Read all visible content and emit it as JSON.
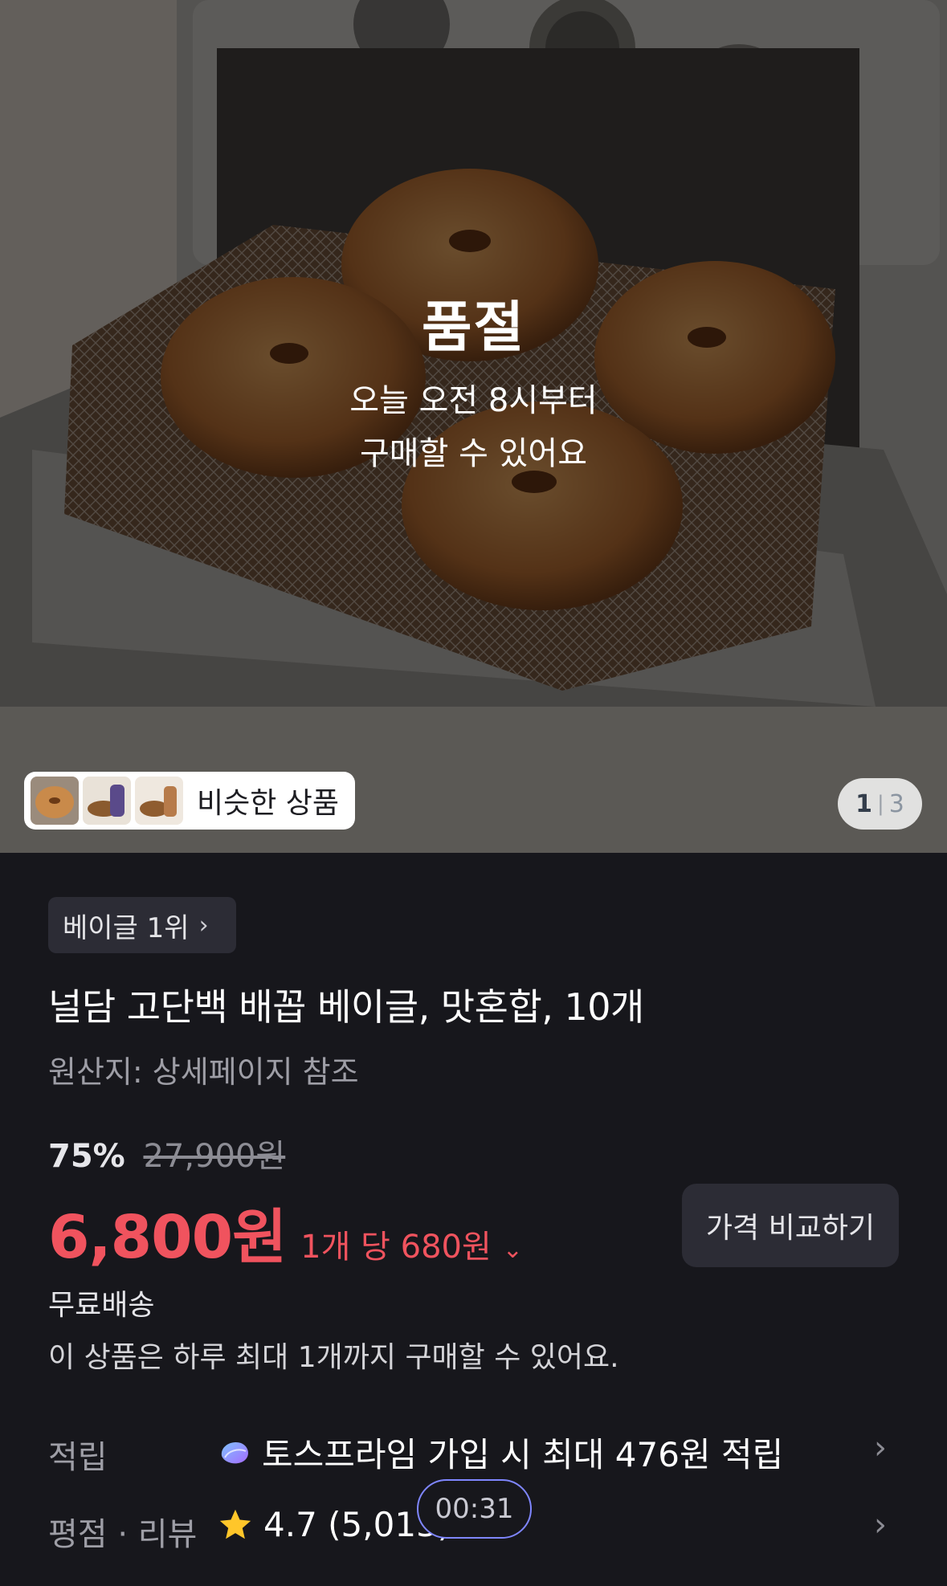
{
  "hero": {
    "soldout_title": "품절",
    "soldout_line1": "오늘 오전 8시부터",
    "soldout_line2": "구매할 수 있어요",
    "similar_label": "비슷한 상품",
    "pager_current": "1",
    "pager_sep": "|",
    "pager_total": "3"
  },
  "product": {
    "rank_label": "베이글 1위",
    "title": "널담 고단백 배꼽 베이글, 맛혼합, 10개",
    "origin": "원산지: 상세페이지 참조",
    "discount_pct": "75%",
    "original_price": "27,900원",
    "price": "6,800원",
    "unit_price": "1개 당 680원",
    "compare_label": "가격 비교하기",
    "shipping": "무료배송",
    "limit_notice": "이 상품은 하루 최대 1개까지 구매할 수 있어요."
  },
  "rows": {
    "points_label": "적립",
    "points_value": "토스프라임 가입 시 최대 476원 적립",
    "rating_label": "평점 · 리뷰",
    "rating_value": "4.7 (5,013)"
  },
  "timer": "00:31",
  "colors": {
    "background": "#17171c",
    "price_red": "#f0535e",
    "chip_bg": "#2c2c35",
    "timer_border": "#7f86ff"
  }
}
